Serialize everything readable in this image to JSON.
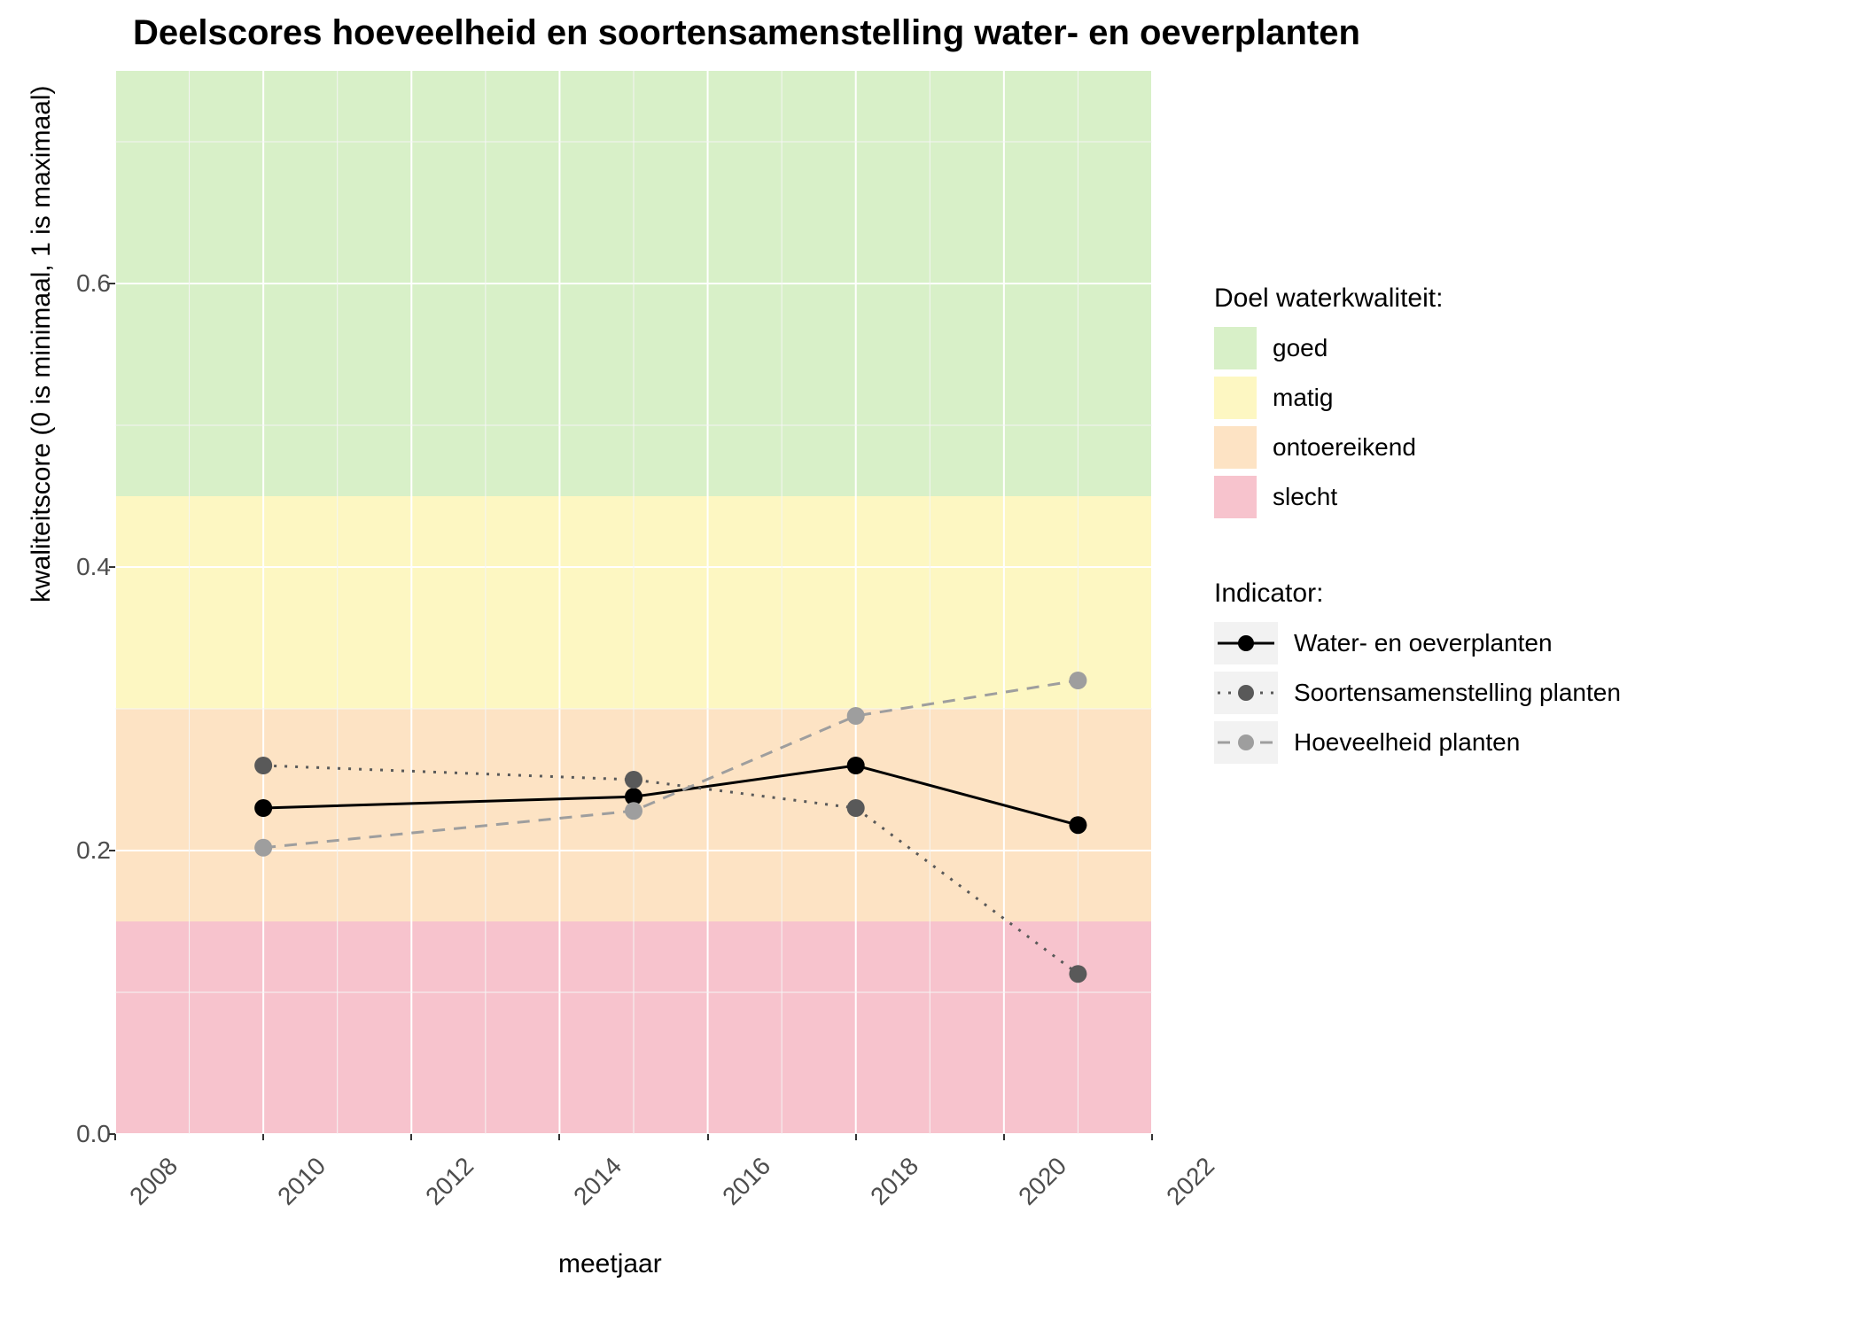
{
  "chart_data": {
    "type": "line",
    "title": "Deelscores hoeveelheid en soortensamenstelling water- en oeverplanten",
    "xlabel": "meetjaar",
    "ylabel": "kwaliteitscore (0 is minimaal, 1 is maximaal)",
    "xlim": [
      2008,
      2022
    ],
    "ylim": [
      0.0,
      0.75
    ],
    "x_ticks": [
      2008,
      2010,
      2012,
      2014,
      2016,
      2018,
      2020,
      2022
    ],
    "y_ticks": [
      0.0,
      0.2,
      0.4,
      0.6
    ],
    "bands": [
      {
        "name": "slecht",
        "from": 0.0,
        "to": 0.15,
        "color": "#f7c3cd"
      },
      {
        "name": "ontoereikend",
        "from": 0.15,
        "to": 0.3,
        "color": "#fde3c4"
      },
      {
        "name": "matig",
        "from": 0.3,
        "to": 0.45,
        "color": "#fdf7c2"
      },
      {
        "name": "goed",
        "from": 0.45,
        "to": 0.75,
        "color": "#d8f0c8"
      }
    ],
    "series": [
      {
        "name": "Water- en oeverplanten",
        "color": "#000000",
        "dash": "solid",
        "x": [
          2010,
          2015,
          2018,
          2021
        ],
        "y": [
          0.23,
          0.238,
          0.26,
          0.218
        ]
      },
      {
        "name": "Soortensamenstelling planten",
        "color": "#595959",
        "dash": "dotted",
        "x": [
          2010,
          2015,
          2018,
          2021
        ],
        "y": [
          0.26,
          0.25,
          0.23,
          0.113
        ]
      },
      {
        "name": "Hoeveelheid planten",
        "color": "#9e9e9e",
        "dash": "dashed",
        "x": [
          2010,
          2015,
          2018,
          2021
        ],
        "y": [
          0.202,
          0.228,
          0.295,
          0.32
        ]
      }
    ],
    "legend_band_title": "Doel waterkwaliteit:",
    "legend_series_title": "Indicator:",
    "band_legend_order": [
      "goed",
      "matig",
      "ontoereikend",
      "slecht"
    ]
  }
}
